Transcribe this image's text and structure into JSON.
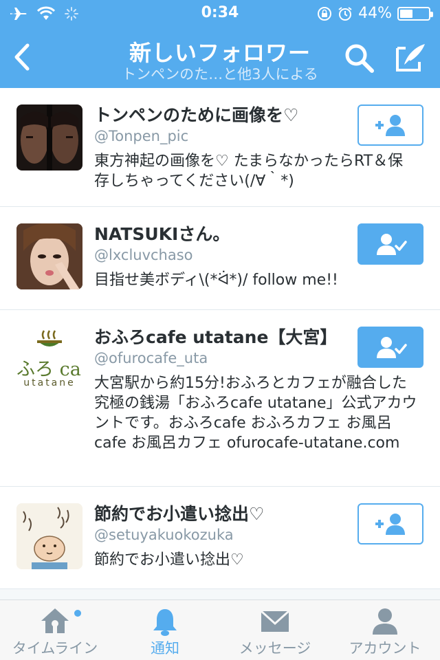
{
  "status_bar": {
    "time": "0:34",
    "battery": "44%",
    "battery_level": 0.44
  },
  "nav": {
    "title": "新しいフォロワー",
    "subtitle": "トンペンのた…と他3人による",
    "back_icon": "chevron-left-icon",
    "search_icon": "search-icon",
    "compose_icon": "compose-icon"
  },
  "followers": [
    {
      "name": "トンペンのために画像を♡",
      "handle": "@Tonpen_pic",
      "bio": "東方神起の画像を♡ たまらなかったらRT＆保存しちゃってください(/∀｀*)",
      "follow_state": "follow"
    },
    {
      "name": "NATSUKIさん。",
      "handle": "@lxcluvchaso",
      "bio": "目指せ美ボディ\\(*ᐛ*)/ follow me!!",
      "follow_state": "following"
    },
    {
      "name": "おふろcafe utatane【大宮】",
      "handle": "@ofurocafe_uta",
      "bio": "大宮駅から約15分!おふろとカフェが融合した究極の銭湯「おふろcafe utatane」公式アカウントです。おふろcafe おふろカフェ お風呂cafe お風呂カフェ ofurocafe-utatane.com",
      "follow_state": "following",
      "logo_text_main": "ふろ ca",
      "logo_text_sub": "utatane"
    },
    {
      "name": "節約でお小遣い捻出♡",
      "handle": "@setuyakuokozuka",
      "bio": "節約でお小遣い捻出♡",
      "follow_state": "follow"
    }
  ],
  "tabs": [
    {
      "label": "タイムライン",
      "icon": "home-icon",
      "active": false
    },
    {
      "label": "通知",
      "icon": "bell-icon",
      "active": true
    },
    {
      "label": "メッセージ",
      "icon": "envelope-icon",
      "active": false
    },
    {
      "label": "アカウント",
      "icon": "person-icon",
      "active": false
    }
  ],
  "colors": {
    "accent": "#55acee",
    "text": "#292f33",
    "secondary_text": "#8899a6"
  }
}
